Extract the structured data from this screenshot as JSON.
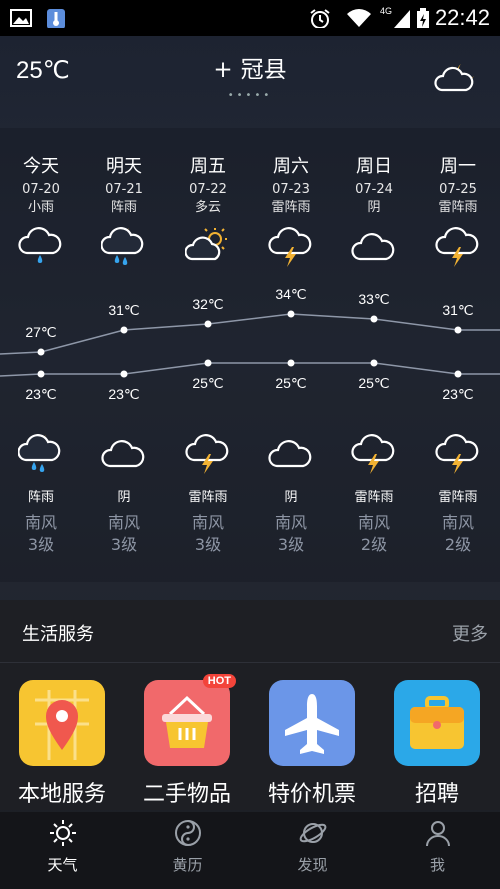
{
  "status_bar": {
    "time": "22:42",
    "network": "4G"
  },
  "header": {
    "current_temp": "25℃",
    "city": "冠县",
    "add_icon": "+",
    "page_dots": "•••••"
  },
  "forecast": [
    {
      "day": "今天",
      "date": "07-20",
      "weather": "小雨",
      "high": "27℃",
      "low": "23℃",
      "night_weather": "阵雨",
      "wind_dir": "南风",
      "wind_level": "3级"
    },
    {
      "day": "明天",
      "date": "07-21",
      "weather": "阵雨",
      "high": "31℃",
      "low": "23℃",
      "night_weather": "阴",
      "wind_dir": "南风",
      "wind_level": "3级"
    },
    {
      "day": "周五",
      "date": "07-22",
      "weather": "多云",
      "high": "32℃",
      "low": "25℃",
      "night_weather": "雷阵雨",
      "wind_dir": "南风",
      "wind_level": "3级"
    },
    {
      "day": "周六",
      "date": "07-23",
      "weather": "雷阵雨",
      "high": "34℃",
      "low": "25℃",
      "night_weather": "阴",
      "wind_dir": "南风",
      "wind_level": "3级"
    },
    {
      "day": "周日",
      "date": "07-24",
      "weather": "阴",
      "high": "33℃",
      "low": "25℃",
      "night_weather": "雷阵雨",
      "wind_dir": "南风",
      "wind_level": "2级"
    },
    {
      "day": "周一",
      "date": "07-25",
      "weather": "雷阵雨",
      "high": "31℃",
      "low": "23℃",
      "night_weather": "雷阵雨",
      "wind_dir": "南风",
      "wind_level": "2级"
    }
  ],
  "life_services": {
    "title": "生活服务",
    "more": "更多",
    "items": [
      {
        "label": "本地服务",
        "icon": "map-pin-icon",
        "color": "#f7c531"
      },
      {
        "label": "二手物品",
        "icon": "basket-icon",
        "color": "#f1696b",
        "badge": "HOT"
      },
      {
        "label": "特价机票",
        "icon": "airplane-icon",
        "color": "#6b96e8"
      },
      {
        "label": "招聘",
        "icon": "briefcase-icon",
        "color": "#2ba8e8"
      }
    ]
  },
  "nav": [
    {
      "label": "天气",
      "icon": "sun-icon",
      "active": true
    },
    {
      "label": "黄历",
      "icon": "yin-yang-icon",
      "active": false
    },
    {
      "label": "发现",
      "icon": "planet-icon",
      "active": false
    },
    {
      "label": "我",
      "icon": "user-icon",
      "active": false
    }
  ]
}
